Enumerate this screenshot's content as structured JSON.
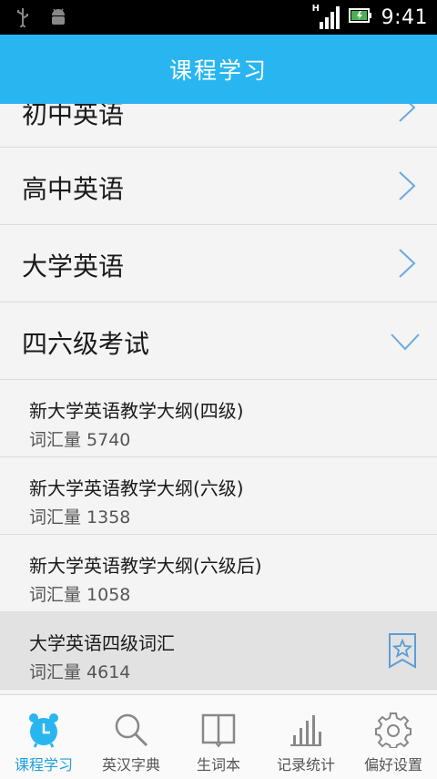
{
  "status_bar": {
    "time": "9:41",
    "signal_indicator": "H"
  },
  "app_bar": {
    "title": "课程学习"
  },
  "categories": [
    {
      "label": "初中英语",
      "state": "collapsed"
    },
    {
      "label": "高中英语",
      "state": "collapsed"
    },
    {
      "label": "大学英语",
      "state": "collapsed"
    },
    {
      "label": "四六级考试",
      "state": "expanded"
    }
  ],
  "courses": [
    {
      "title": "新大学英语教学大纲(四级)",
      "count_label": "词汇量",
      "count": "5740"
    },
    {
      "title": "新大学英语教学大纲(六级)",
      "count_label": "词汇量",
      "count": "1358"
    },
    {
      "title": "新大学英语教学大纲(六级后)",
      "count_label": "词汇量",
      "count": "1058"
    },
    {
      "title": "大学英语四级词汇",
      "count_label": "词汇量",
      "count": "4614",
      "selected": true
    }
  ],
  "bottom_nav": [
    {
      "label": "课程学习",
      "icon": "alarm-clock-icon",
      "active": true
    },
    {
      "label": "英汉字典",
      "icon": "magnifier-icon"
    },
    {
      "label": "生词本",
      "icon": "book-icon"
    },
    {
      "label": "记录统计",
      "icon": "bar-chart-icon"
    },
    {
      "label": "偏好设置",
      "icon": "gear-icon"
    }
  ],
  "colors": {
    "accent": "#29b6f0",
    "active_nav": "#1e9fe0",
    "chevron": "#6aa9e0"
  }
}
